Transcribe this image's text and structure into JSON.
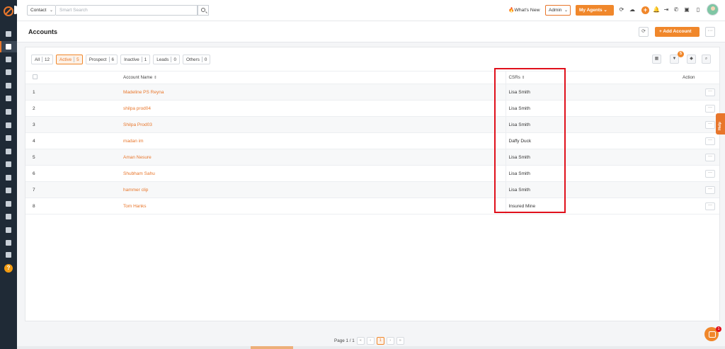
{
  "topbar": {
    "context_select": "Contact",
    "search_placeholder": "Smart Search",
    "whats_new": "What's New",
    "role_select": "Admin",
    "my_agents": "My Agents"
  },
  "header": {
    "title": "Accounts",
    "add_button": "+ Add Account",
    "more": "···"
  },
  "filters": [
    {
      "label": "All",
      "count": "12"
    },
    {
      "label": "Active",
      "count": "5"
    },
    {
      "label": "Prospect",
      "count": "6"
    },
    {
      "label": "Inactive",
      "count": "1"
    },
    {
      "label": "Leads",
      "count": "0"
    },
    {
      "label": "Others",
      "count": "0"
    }
  ],
  "toolbar": {
    "filter_badge": "5"
  },
  "table": {
    "columns": {
      "name": "Account Name",
      "csr": "CSRs",
      "action": "Action"
    },
    "rows": [
      {
        "num": "1",
        "name": "Madeline PS Reyna",
        "csr": "Lisa Smith"
      },
      {
        "num": "2",
        "name": "shilpa prod04",
        "csr": "Lisa Smith"
      },
      {
        "num": "3",
        "name": "Shilpa Prod03",
        "csr": "Lisa Smith"
      },
      {
        "num": "4",
        "name": "madan im",
        "csr": "Daffy Duck"
      },
      {
        "num": "5",
        "name": "Aman Nesure",
        "csr": "Lisa Smith"
      },
      {
        "num": "6",
        "name": "Shubham Sahu",
        "csr": "Lisa Smith"
      },
      {
        "num": "7",
        "name": "hammer clip",
        "csr": "Lisa Smith"
      },
      {
        "num": "8",
        "name": "Tom Hanks",
        "csr": "Insured Mine"
      }
    ],
    "row_more": "···"
  },
  "pagination": {
    "text": "Page 1 / 1",
    "current": "1"
  },
  "help_tab": "Help",
  "chat_count": "1",
  "colors": {
    "accent": "#f0872b",
    "highlight": "#e0101b",
    "sidebar": "#1f2a36"
  }
}
